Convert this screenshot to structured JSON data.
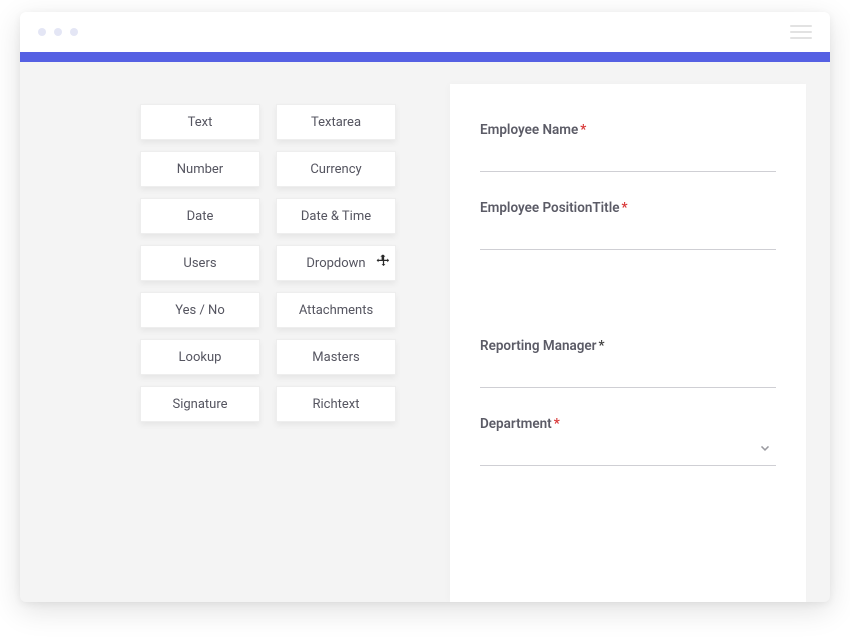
{
  "accent_color": "#5560e3",
  "palette": {
    "items": [
      {
        "label": "Text"
      },
      {
        "label": "Textarea"
      },
      {
        "label": "Number"
      },
      {
        "label": "Currency"
      },
      {
        "label": "Date"
      },
      {
        "label": "Date & Time"
      },
      {
        "label": "Users"
      },
      {
        "label": "Dropdown",
        "dragging": true
      },
      {
        "label": "Yes / No"
      },
      {
        "label": "Attachments"
      },
      {
        "label": "Lookup"
      },
      {
        "label": "Masters"
      },
      {
        "label": "Signature"
      },
      {
        "label": "Richtext"
      }
    ]
  },
  "form": {
    "fields": [
      {
        "label": "Employee Name",
        "required": true,
        "type": "text",
        "value": ""
      },
      {
        "label": "Employee PositionTitle",
        "required": true,
        "type": "text",
        "value": ""
      },
      {
        "label": "Reporting Manager",
        "required": true,
        "type": "text",
        "value": ""
      },
      {
        "label": "Department",
        "required": true,
        "type": "select",
        "value": ""
      }
    ]
  }
}
